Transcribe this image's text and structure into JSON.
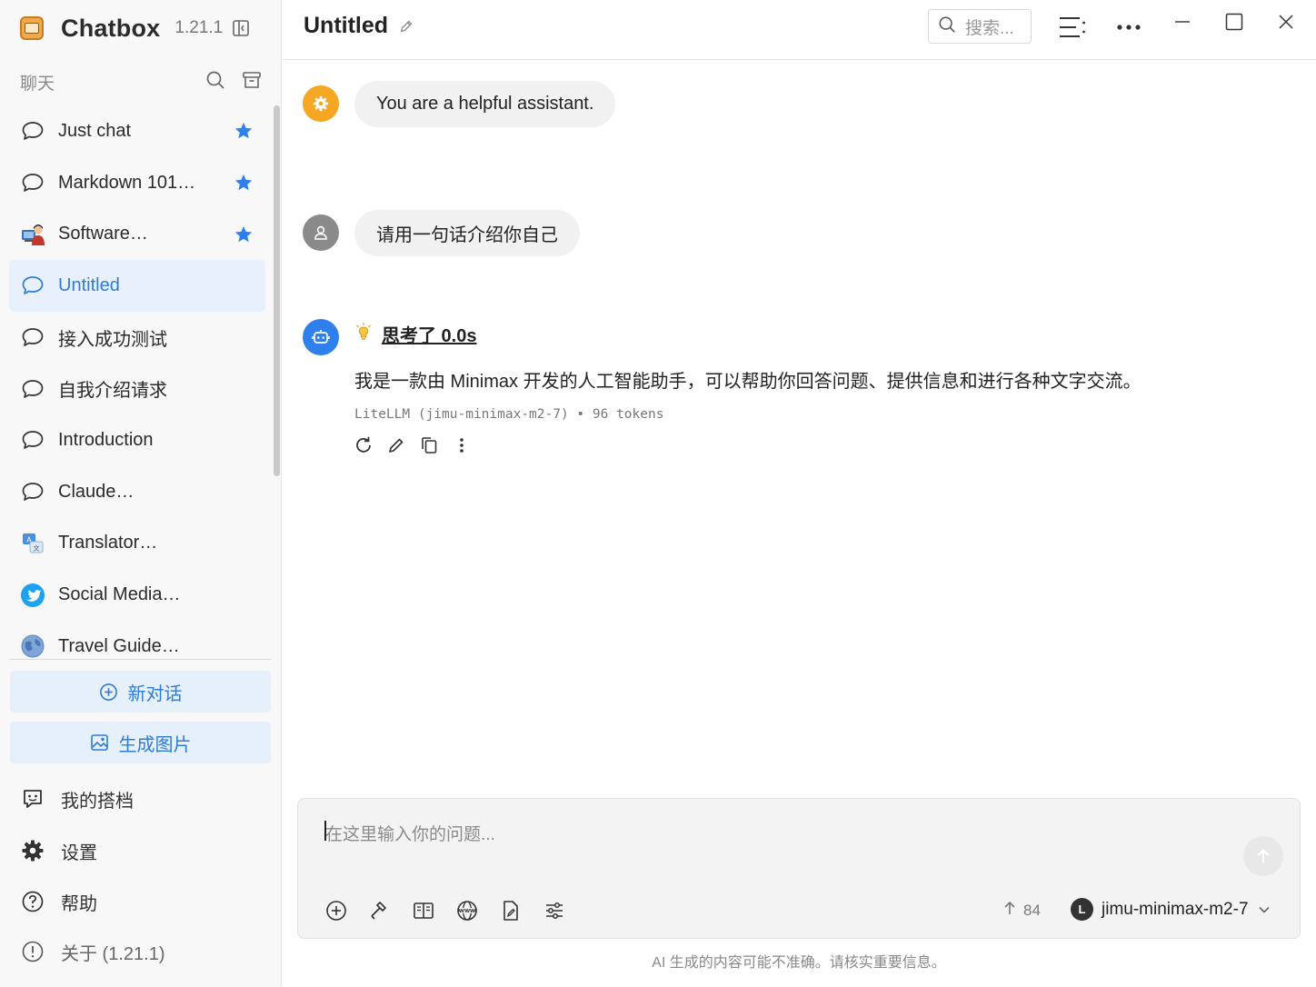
{
  "app": {
    "name": "Chatbox",
    "version": "1.21.1"
  },
  "sidebar": {
    "section_title": "聊天",
    "chats": [
      {
        "label": "Just chat",
        "icon": "chat-bubble-icon",
        "starred": true,
        "active": false
      },
      {
        "label": "Markdown 101…",
        "icon": "chat-bubble-icon",
        "starred": true,
        "active": false
      },
      {
        "label": "Software…",
        "icon": "developer-avatar-icon",
        "starred": true,
        "active": false
      },
      {
        "label": "Untitled",
        "icon": "chat-bubble-icon",
        "starred": false,
        "active": true
      },
      {
        "label": "接入成功测试",
        "icon": "chat-bubble-icon",
        "starred": false,
        "active": false
      },
      {
        "label": "自我介绍请求",
        "icon": "chat-bubble-icon",
        "starred": false,
        "active": false
      },
      {
        "label": "Introduction",
        "icon": "chat-bubble-icon",
        "starred": false,
        "active": false
      },
      {
        "label": "Claude…",
        "icon": "chat-bubble-icon",
        "starred": false,
        "active": false
      },
      {
        "label": "Translator…",
        "icon": "translator-avatar-icon",
        "starred": false,
        "active": false
      },
      {
        "label": "Social Media…",
        "icon": "twitter-bird-icon",
        "starred": false,
        "active": false
      },
      {
        "label": "Travel Guide…",
        "icon": "globe-avatar-icon",
        "starred": false,
        "active": false
      }
    ],
    "new_chat_label": "新对话",
    "generate_image_label": "生成图片",
    "bottom": {
      "partners": "我的搭档",
      "settings": "设置",
      "help": "帮助",
      "about": "关于 (1.21.1)"
    }
  },
  "header": {
    "title": "Untitled",
    "search_placeholder": "搜索..."
  },
  "messages": {
    "system": "You are a helpful assistant.",
    "user": "请用一句话介绍你自己",
    "thinking_label": "思考了 0.0s",
    "assistant": "我是一款由 Minimax 开发的人工智能助手，可以帮助你回答问题、提供信息和进行各种文字交流。",
    "meta": "LiteLLM (jimu-minimax-m2-7) • 96 tokens"
  },
  "composer": {
    "placeholder": "在这里输入你的问题...",
    "token_count": "84",
    "model_initial": "L",
    "model_name": "jimu-minimax-m2-7"
  },
  "disclaimer": "AI 生成的内容可能不准确。请核实重要信息。",
  "colors": {
    "accent": "#2f7cd6",
    "active_bg": "#e7f0fb",
    "star": "#2f80ed",
    "system_avatar": "#f5a623",
    "assistant_avatar": "#2f80ed",
    "user_avatar": "#8a8a8a"
  }
}
